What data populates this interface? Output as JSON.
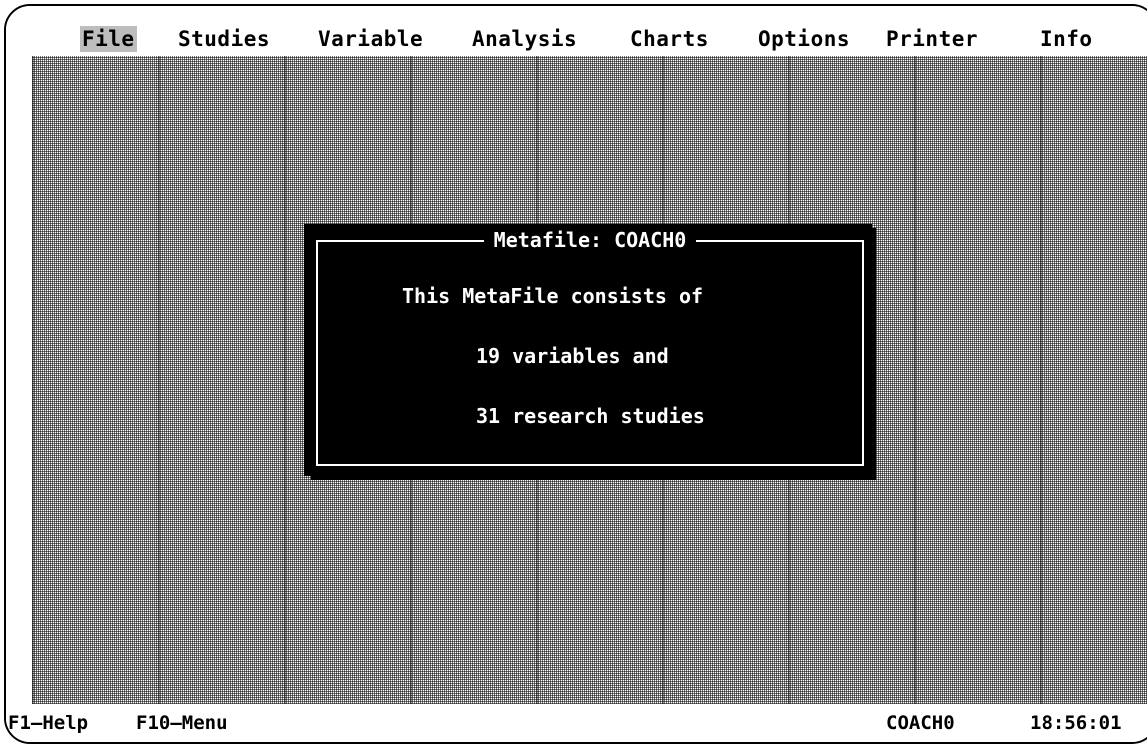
{
  "menu": {
    "items": [
      {
        "label": "File"
      },
      {
        "label": "Studies"
      },
      {
        "label": "Variable"
      },
      {
        "label": "Analysis"
      },
      {
        "label": "Charts"
      },
      {
        "label": "Options"
      },
      {
        "label": "Printer"
      },
      {
        "label": "Info"
      }
    ],
    "active_item": "File"
  },
  "dialog": {
    "title": "Metafile: COACH0",
    "lines": [
      "This MetaFile consists of",
      "19 variables and",
      "31 research studies"
    ]
  },
  "status": {
    "help_key": "F1—Help",
    "menu_key": "F10—Menu",
    "file_name": "COACH0",
    "clock": "18:56:01"
  },
  "colors": {
    "background": "#ffffff",
    "foreground": "#000000",
    "dialog_background": "#000000",
    "dialog_text": "#ffffff",
    "menu_highlight": "#bdbdbd"
  }
}
